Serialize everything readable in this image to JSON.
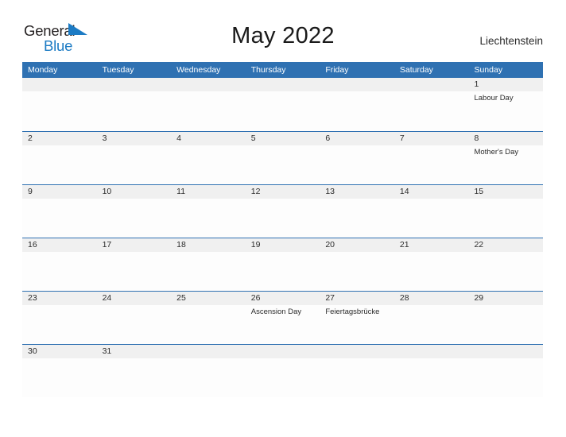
{
  "brand": {
    "word_one": "General",
    "word_two": "Blue",
    "flag_icon": "blue-flag-triangle-icon",
    "color_dark": "#231f20",
    "color_blue": "#1c7bc4"
  },
  "header": {
    "title": "May 2022",
    "country": "Liechtenstein"
  },
  "theme": {
    "header_blue": "#2f71b2",
    "daynum_band_gray": "#f0f0f0",
    "cell_white": "#fdfdfd",
    "text_dark": "#2b2b2b"
  },
  "calendar": {
    "weekdays": [
      "Monday",
      "Tuesday",
      "Wednesday",
      "Thursday",
      "Friday",
      "Saturday",
      "Sunday"
    ],
    "weeks": [
      {
        "days": [
          {
            "num": "",
            "events": []
          },
          {
            "num": "",
            "events": []
          },
          {
            "num": "",
            "events": []
          },
          {
            "num": "",
            "events": []
          },
          {
            "num": "",
            "events": []
          },
          {
            "num": "",
            "events": []
          },
          {
            "num": "1",
            "events": [
              "Labour Day"
            ]
          }
        ]
      },
      {
        "days": [
          {
            "num": "2",
            "events": []
          },
          {
            "num": "3",
            "events": []
          },
          {
            "num": "4",
            "events": []
          },
          {
            "num": "5",
            "events": []
          },
          {
            "num": "6",
            "events": []
          },
          {
            "num": "7",
            "events": []
          },
          {
            "num": "8",
            "events": [
              "Mother's Day"
            ]
          }
        ]
      },
      {
        "days": [
          {
            "num": "9",
            "events": []
          },
          {
            "num": "10",
            "events": []
          },
          {
            "num": "11",
            "events": []
          },
          {
            "num": "12",
            "events": []
          },
          {
            "num": "13",
            "events": []
          },
          {
            "num": "14",
            "events": []
          },
          {
            "num": "15",
            "events": []
          }
        ]
      },
      {
        "days": [
          {
            "num": "16",
            "events": []
          },
          {
            "num": "17",
            "events": []
          },
          {
            "num": "18",
            "events": []
          },
          {
            "num": "19",
            "events": []
          },
          {
            "num": "20",
            "events": []
          },
          {
            "num": "21",
            "events": []
          },
          {
            "num": "22",
            "events": []
          }
        ]
      },
      {
        "days": [
          {
            "num": "23",
            "events": []
          },
          {
            "num": "24",
            "events": []
          },
          {
            "num": "25",
            "events": []
          },
          {
            "num": "26",
            "events": [
              "Ascension Day"
            ]
          },
          {
            "num": "27",
            "events": [
              "Feiertagsbrücke"
            ]
          },
          {
            "num": "28",
            "events": []
          },
          {
            "num": "29",
            "events": []
          }
        ]
      },
      {
        "days": [
          {
            "num": "30",
            "events": []
          },
          {
            "num": "31",
            "events": []
          },
          {
            "num": "",
            "events": []
          },
          {
            "num": "",
            "events": []
          },
          {
            "num": "",
            "events": []
          },
          {
            "num": "",
            "events": []
          },
          {
            "num": "",
            "events": []
          }
        ]
      }
    ]
  }
}
